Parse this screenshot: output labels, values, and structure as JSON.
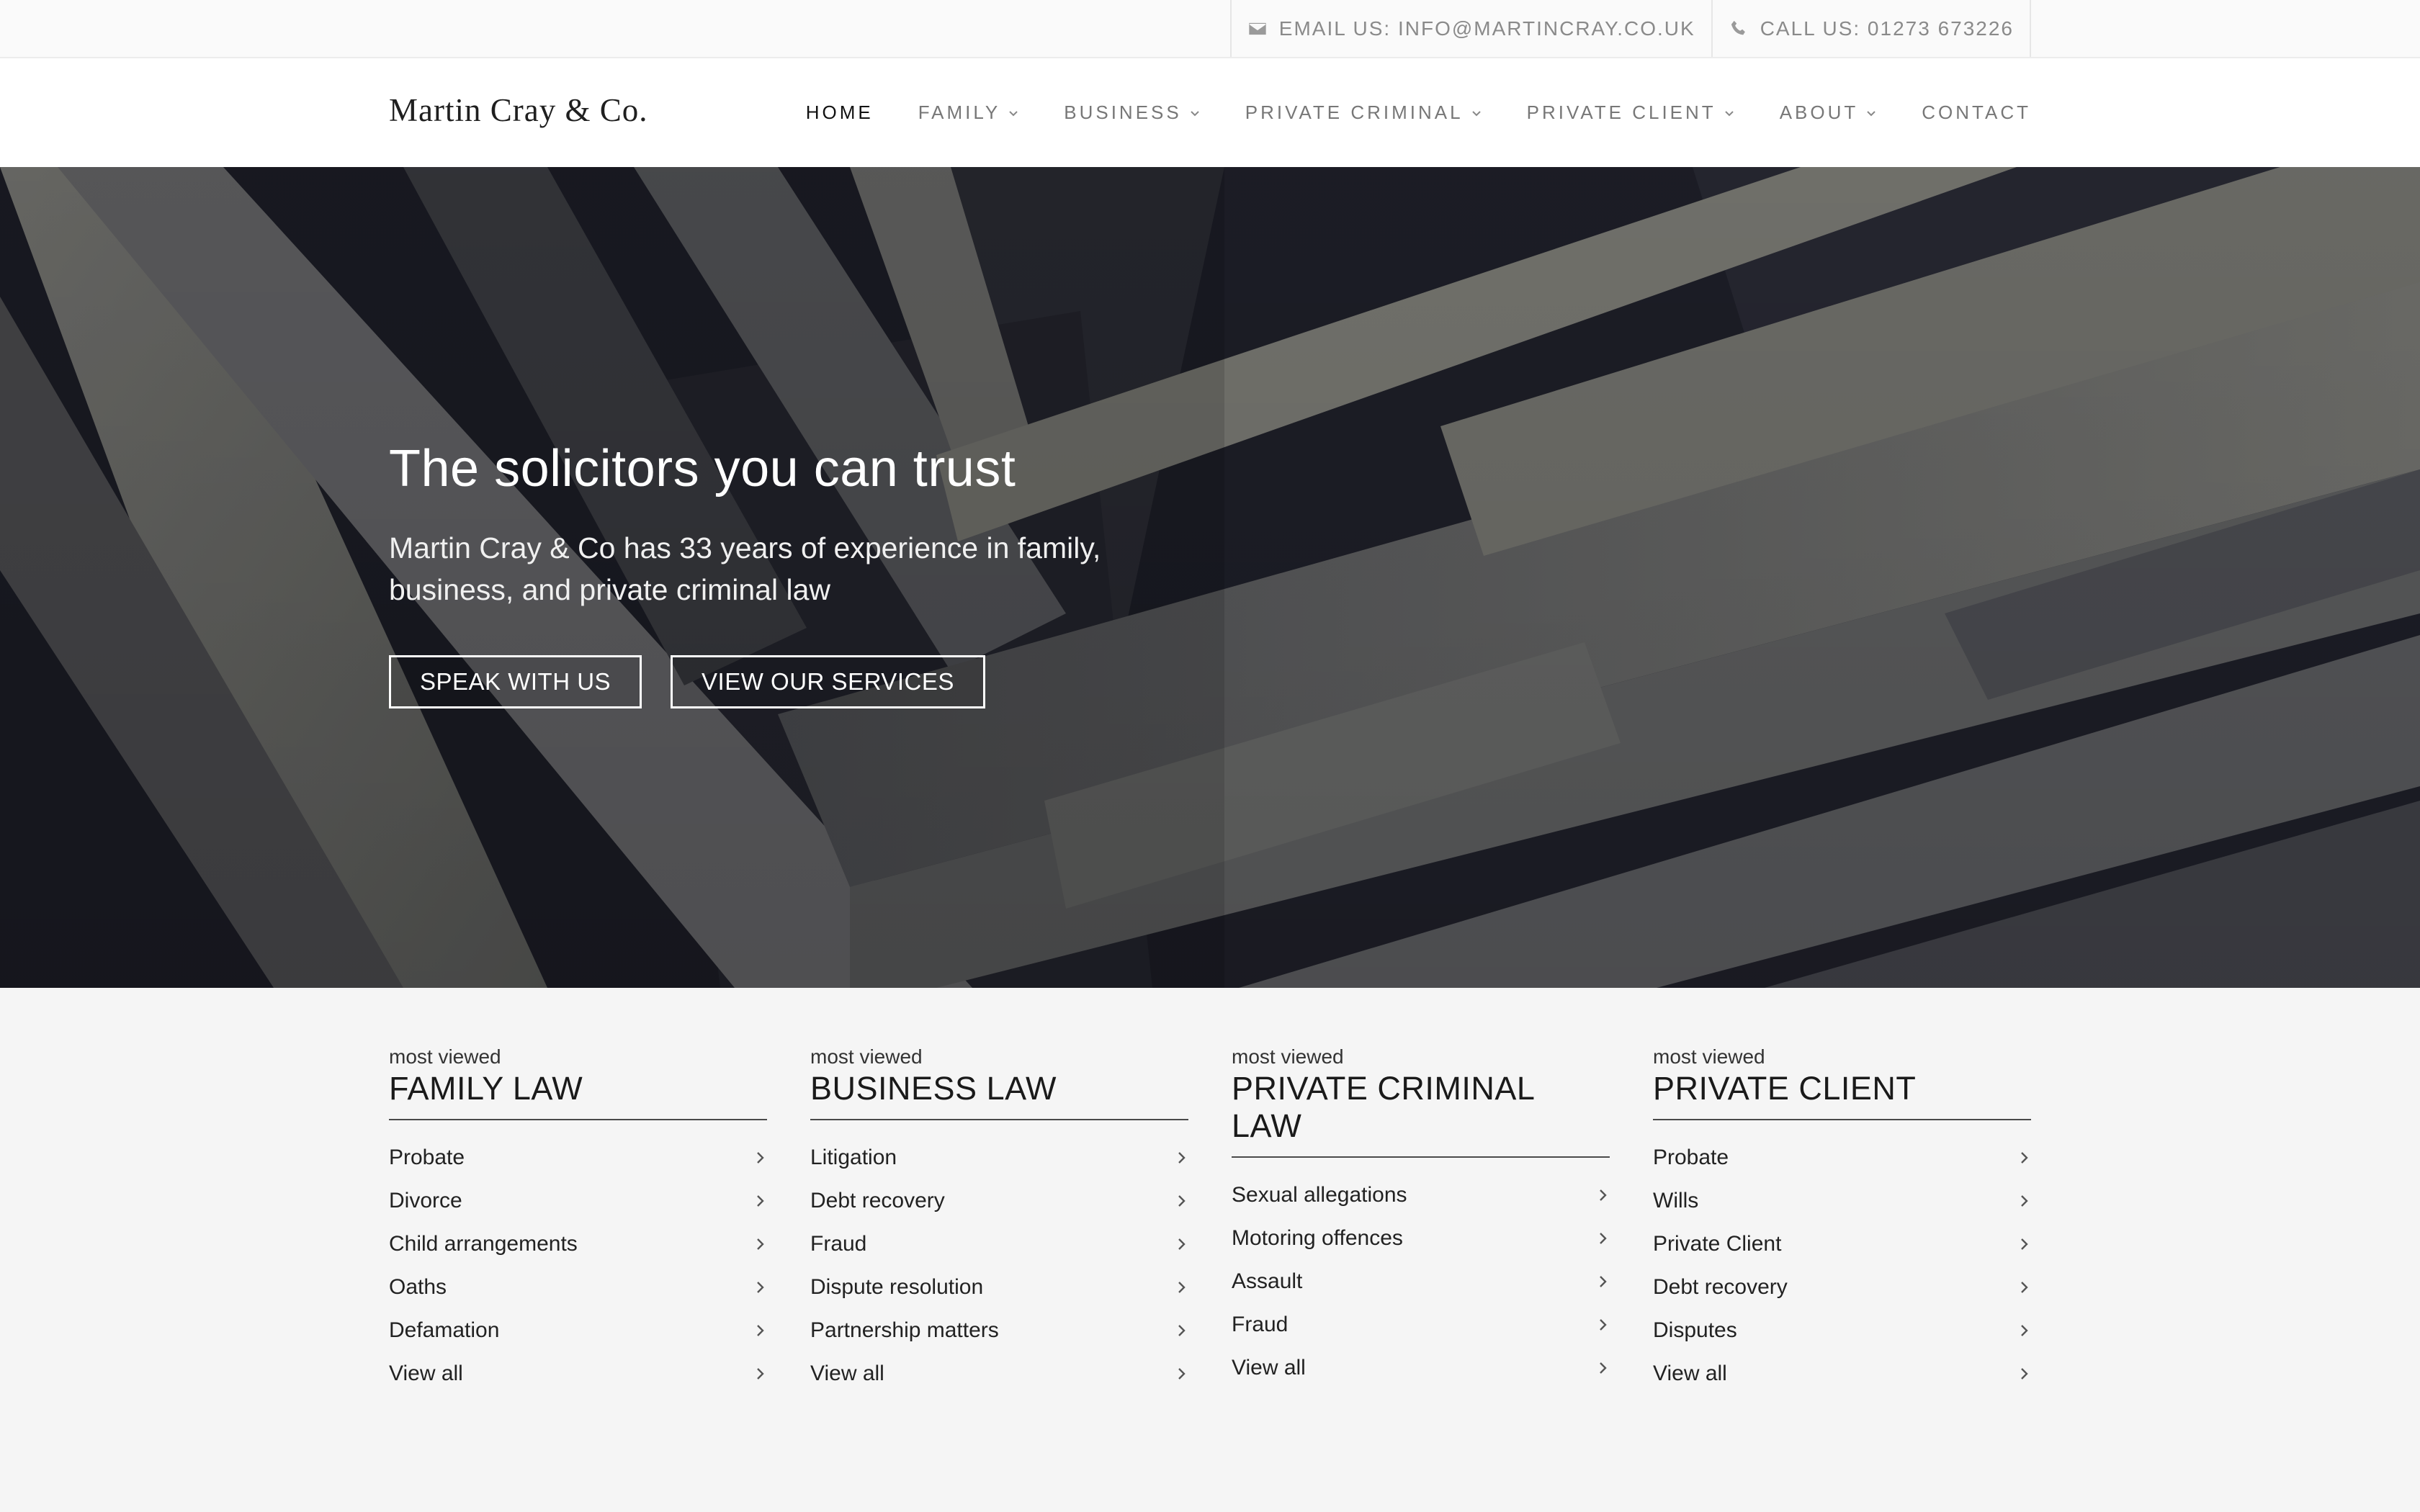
{
  "topbar": {
    "email_label": "EMAIL US: INFO@MARTINCRAY.CO.UK",
    "email_icon": "envelope-icon",
    "phone_label": "CALL US: 01273 673226",
    "phone_icon": "phone-icon"
  },
  "brand": {
    "logo_text": "Martin Cray & Co."
  },
  "nav": {
    "items": [
      {
        "label": "HOME",
        "active": true,
        "dropdown": false
      },
      {
        "label": "FAMILY",
        "dropdown": true
      },
      {
        "label": "BUSINESS",
        "dropdown": true
      },
      {
        "label": "PRIVATE CRIMINAL",
        "dropdown": true
      },
      {
        "label": "PRIVATE CLIENT",
        "dropdown": true
      },
      {
        "label": "ABOUT",
        "dropdown": true
      },
      {
        "label": "CONTACT",
        "dropdown": false
      }
    ]
  },
  "hero": {
    "title": "The solicitors you can trust",
    "subtitle": "Martin Cray & Co has 33 years of experience in family, business, and private criminal law",
    "primary_button": "SPEAK WITH US",
    "secondary_button": "VIEW OUR SERVICES"
  },
  "columns": [
    {
      "kicker": "most viewed",
      "title": "FAMILY LAW",
      "links": [
        "Probate",
        "Divorce",
        "Child arrangements",
        "Oaths",
        "Defamation",
        "View all"
      ]
    },
    {
      "kicker": "most viewed",
      "title": "BUSINESS LAW",
      "links": [
        "Litigation",
        "Debt recovery",
        "Fraud",
        "Dispute resolution",
        "Partnership matters",
        "View all"
      ]
    },
    {
      "kicker": "most viewed",
      "title": "PRIVATE CRIMINAL LAW",
      "links": [
        "Sexual allegations",
        "Motoring offences",
        "Assault",
        "Fraud",
        "View all"
      ]
    },
    {
      "kicker": "most viewed",
      "title": "PRIVATE CLIENT",
      "links": [
        "Probate",
        "Wills",
        "Private Client",
        "Debt recovery",
        "Disputes",
        "View all"
      ]
    }
  ],
  "colors": {
    "hero_dark": "#1d1e27",
    "beam_light": "#6e6e69",
    "page_bg": "#f5f5f5"
  }
}
